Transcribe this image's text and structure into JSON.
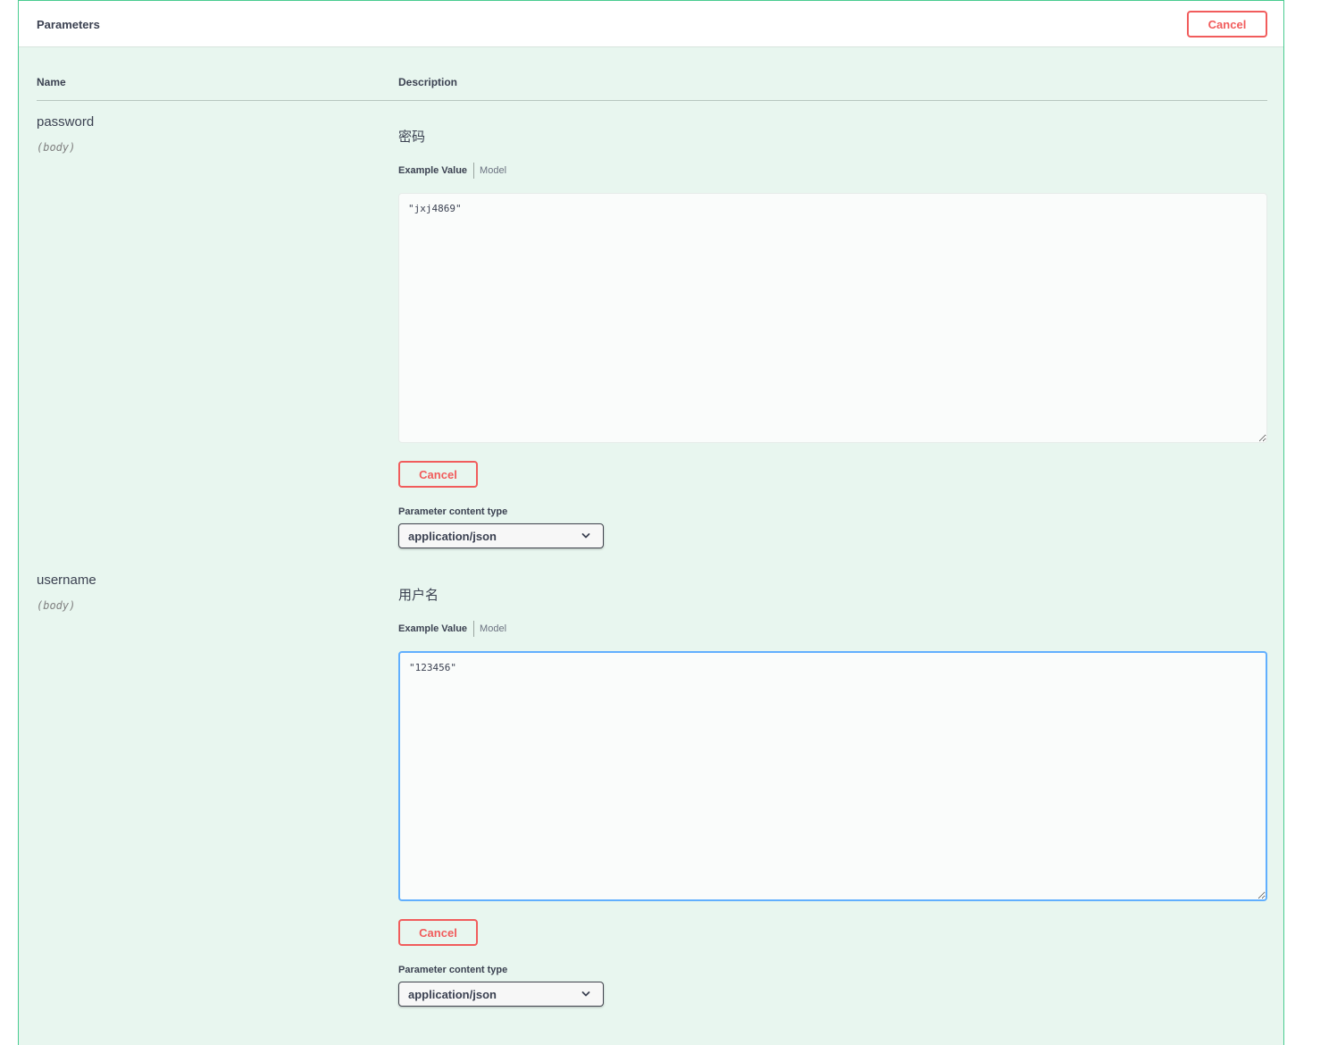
{
  "section": {
    "title": "Parameters",
    "cancel_label": "Cancel"
  },
  "columns": {
    "name": "Name",
    "description": "Description"
  },
  "parameters": [
    {
      "name": "password",
      "in": "(body)",
      "description": "密码",
      "tabs": {
        "example": "Example Value",
        "model": "Model"
      },
      "value": "\"jxj4869\"",
      "cancel_label": "Cancel",
      "content_type_label": "Parameter content type",
      "content_type": "application/json",
      "icon": "chevron-down-icon"
    },
    {
      "name": "username",
      "in": "(body)",
      "description": "用户名",
      "tabs": {
        "example": "Example Value",
        "model": "Model"
      },
      "value": "\"123456\"",
      "cancel_label": "Cancel",
      "content_type_label": "Parameter content type",
      "content_type": "application/json",
      "icon": "chevron-down-icon"
    }
  ],
  "colors": {
    "accent_green": "#49cc90",
    "cancel_red": "#f15c5c",
    "focus_blue": "#61affe",
    "panel_bg": "#e8f6ef"
  }
}
